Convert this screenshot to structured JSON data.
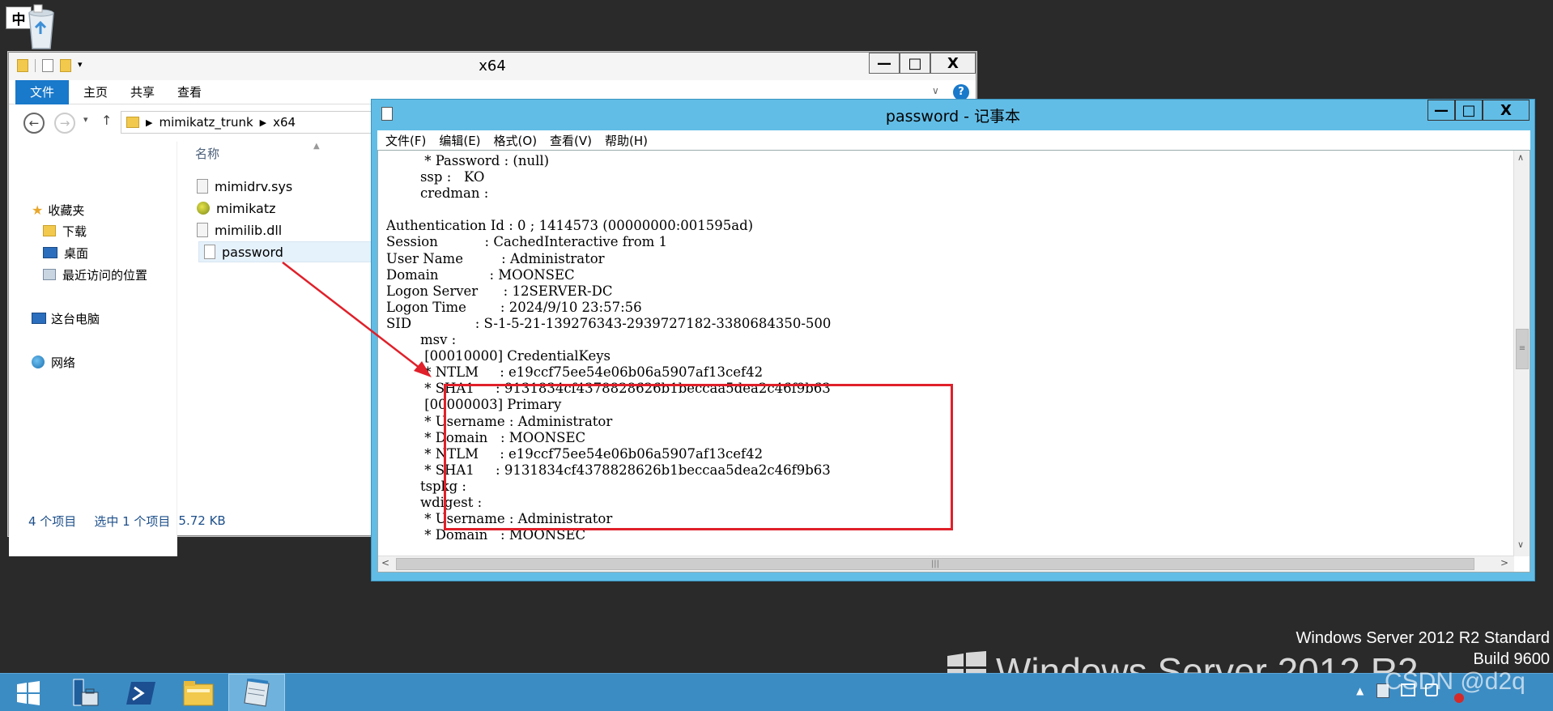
{
  "desktop": {
    "ime_indicator": "中",
    "watermark_title": "Windows Server 2012 R2",
    "watermark_edition": "Windows Server 2012 R2 Standard",
    "watermark_build": "Build 9600",
    "csdn_watermark": "CSDN @d2q",
    "recycle_bin_icon": "recycle-bin-icon"
  },
  "taskbar": {
    "items": [
      "start-icon",
      "server-manager-icon",
      "powershell-icon",
      "file-explorer-icon",
      "notepad-icon"
    ],
    "active_index": 4
  },
  "explorer": {
    "title": "x64",
    "ribbon_tabs": [
      "文件",
      "主页",
      "共享",
      "查看"
    ],
    "breadcrumb": [
      "mimikatz_trunk",
      "x64"
    ],
    "nav": {
      "favorites_label": "收藏夹",
      "favorites": [
        "下载",
        "桌面",
        "最近访问的位置"
      ],
      "this_pc": "这台电脑",
      "network": "网络"
    },
    "column_header": "名称",
    "files": [
      {
        "name": "mimidrv.sys",
        "icon": "sys-file-icon"
      },
      {
        "name": "mimikatz",
        "icon": "mimikatz-exe-icon"
      },
      {
        "name": "mimilib.dll",
        "icon": "dll-file-icon"
      },
      {
        "name": "password",
        "icon": "text-file-icon",
        "selected": true
      }
    ],
    "status": {
      "item_count": "4 个项目",
      "selection": "选中 1 个项目",
      "size": "5.72 KB"
    },
    "buttons": {
      "minimize": "—",
      "maximize": "□",
      "close": "X"
    }
  },
  "notepad": {
    "title": "password - 记事本",
    "menu": [
      "文件(F)",
      "编辑(E)",
      "格式(O)",
      "查看(V)",
      "帮助(H)"
    ],
    "lines": [
      "         * Password : (null)",
      "        ssp :   KO",
      "        credman :",
      "",
      "Authentication Id : 0 ; 1414573 (00000000:001595ad)",
      "Session           : CachedInteractive from 1",
      "User Name         : Administrator",
      "Domain            : MOONSEC",
      "Logon Server      : 12SERVER-DC",
      "Logon Time        : 2024/9/10 23:57:56",
      "SID               : S-1-5-21-139276343-2939727182-3380684350-500",
      "        msv :",
      "         [00010000] CredentialKeys",
      "         * NTLM     : e19ccf75ee54e06b06a5907af13cef42",
      "         * SHA1     : 9131834cf4378828626b1beccaa5dea2c46f9b63",
      "         [00000003] Primary",
      "         * Username : Administrator",
      "         * Domain   : MOONSEC",
      "         * NTLM     : e19ccf75ee54e06b06a5907af13cef42",
      "         * SHA1     : 9131834cf4378828626b1beccaa5dea2c46f9b63",
      "        tspkg :",
      "        wdigest :",
      "         * Username : Administrator",
      "         * Domain   : MOONSEC"
    ]
  },
  "annotation": {
    "highlight_color": "#e0202a"
  }
}
